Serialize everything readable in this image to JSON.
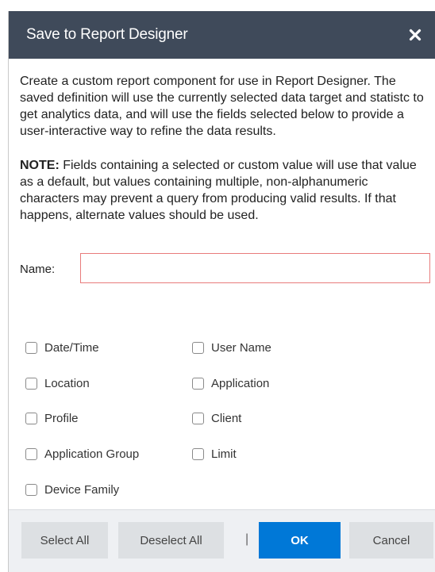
{
  "dialog": {
    "title": "Save to Report Designer",
    "close_icon": "close-icon",
    "description": "Create a custom report component for use in Report Designer.  The saved definition will use the currently selected data target and statistc to get analytics data, and will use the fields selected below to provide a user-interactive way to refine the data results.",
    "note_label": "NOTE:",
    "note_text": " Fields containing a selected or custom value will use that value as a default, but values containing multiple, non-alphanumeric characters may prevent a query from producing valid results.  If that happens, alternate values should be used.",
    "name_label": "Name:",
    "name_value": "",
    "fields": [
      {
        "label": "Date/Time",
        "checked": false
      },
      {
        "label": "User Name",
        "checked": false
      },
      {
        "label": "Location",
        "checked": false
      },
      {
        "label": "Application",
        "checked": false
      },
      {
        "label": "Profile",
        "checked": false
      },
      {
        "label": "Client",
        "checked": false
      },
      {
        "label": "Application Group",
        "checked": false
      },
      {
        "label": "Limit",
        "checked": false
      },
      {
        "label": "Device Family",
        "checked": false
      }
    ],
    "buttons": {
      "select_all": "Select All",
      "deselect_all": "Deselect All",
      "separator": "|",
      "ok": "OK",
      "cancel": "Cancel"
    },
    "colors": {
      "titlebar": "#3f4a5a",
      "primary": "#0078d7",
      "input_border": "#e87c7c"
    }
  }
}
